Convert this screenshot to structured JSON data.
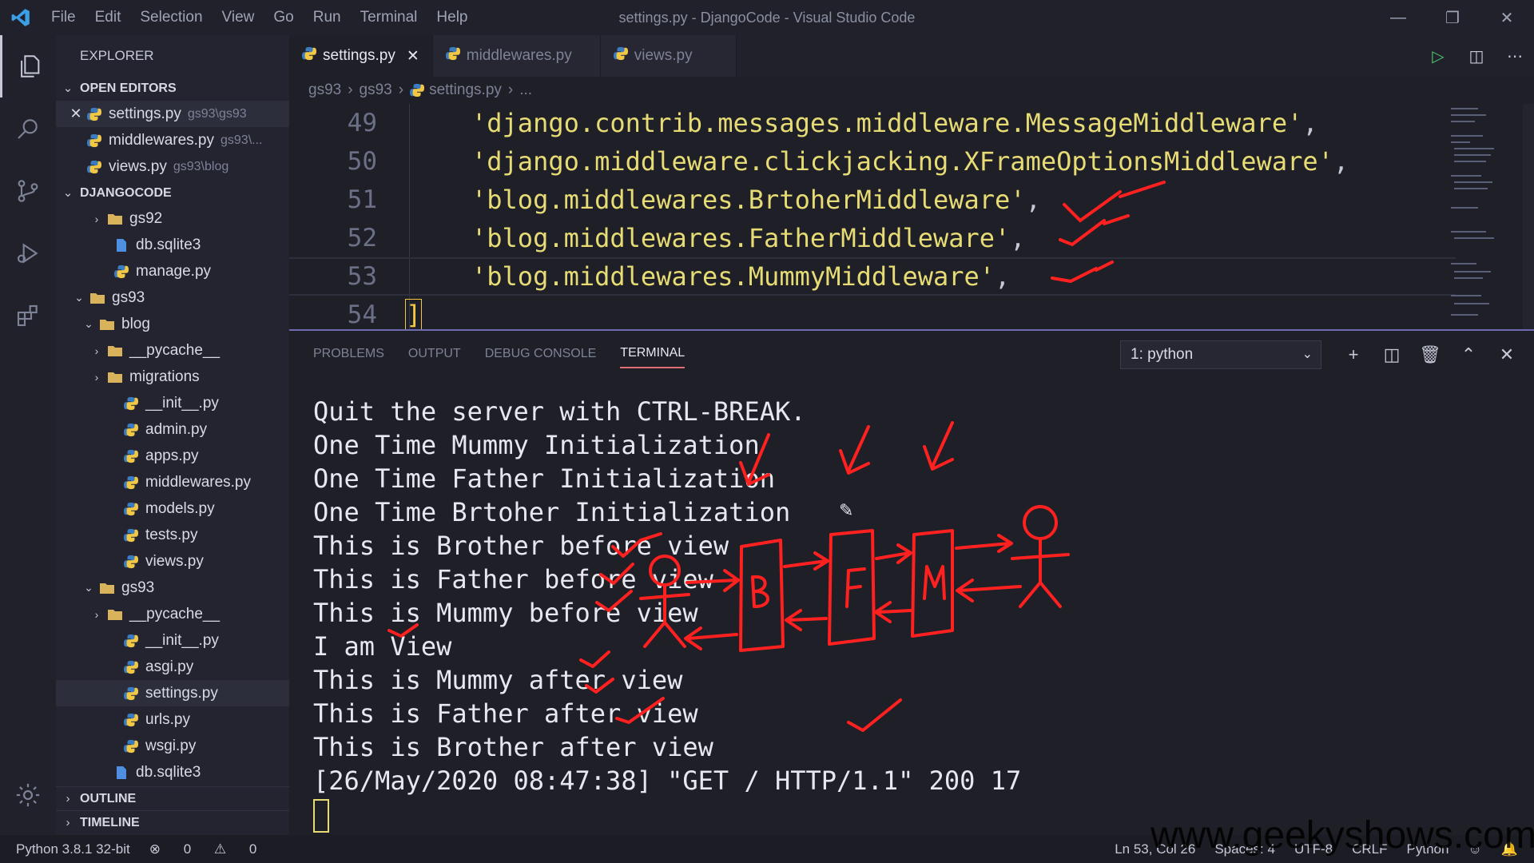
{
  "window": {
    "title": "settings.py - DjangoCode - Visual Studio Code",
    "menu": [
      "File",
      "Edit",
      "Selection",
      "View",
      "Go",
      "Run",
      "Terminal",
      "Help"
    ]
  },
  "sidebar": {
    "header": "EXPLORER",
    "open_editors_label": "OPEN EDITORS",
    "open_editors": [
      {
        "name": "settings.py",
        "path": "gs93\\gs93"
      },
      {
        "name": "middlewares.py",
        "path": "gs93\\..."
      },
      {
        "name": "views.py",
        "path": "gs93\\blog"
      }
    ],
    "project_label": "DJANGOCODE",
    "tree": [
      {
        "name": "gs92"
      },
      {
        "name": "db.sqlite3"
      },
      {
        "name": "manage.py"
      },
      {
        "name": "gs93"
      },
      {
        "name": "blog"
      },
      {
        "name": "__pycache__"
      },
      {
        "name": "migrations"
      },
      {
        "name": "__init__.py"
      },
      {
        "name": "admin.py"
      },
      {
        "name": "apps.py"
      },
      {
        "name": "middlewares.py"
      },
      {
        "name": "models.py"
      },
      {
        "name": "tests.py"
      },
      {
        "name": "views.py"
      },
      {
        "name": "gs93"
      },
      {
        "name": "__pycache__"
      },
      {
        "name": "__init__.py"
      },
      {
        "name": "asgi.py"
      },
      {
        "name": "settings.py"
      },
      {
        "name": "urls.py"
      },
      {
        "name": "wsgi.py"
      },
      {
        "name": "db.sqlite3"
      }
    ],
    "outline_label": "OUTLINE",
    "timeline_label": "TIMELINE"
  },
  "tabs": [
    {
      "label": "settings.py"
    },
    {
      "label": "middlewares.py"
    },
    {
      "label": "views.py"
    }
  ],
  "breadcrumb": [
    "gs93",
    "gs93",
    "settings.py",
    "..."
  ],
  "editor": {
    "lines": [
      {
        "num": "49",
        "text": "'django.contrib.messages.middleware.MessageMiddleware'",
        "punct": ","
      },
      {
        "num": "50",
        "text": "'django.middleware.clickjacking.XFrameOptionsMiddleware'",
        "punct": ","
      },
      {
        "num": "51",
        "text": "'blog.middlewares.BrtoherMiddleware'",
        "punct": ","
      },
      {
        "num": "52",
        "text": "'blog.middlewares.FatherMiddleware'",
        "punct": ","
      },
      {
        "num": "53",
        "text": "'blog.middlewares.MummyMiddleware'",
        "punct": ","
      },
      {
        "num": "54",
        "text": "",
        "punct": "]"
      }
    ]
  },
  "panel": {
    "tabs": [
      "PROBLEMS",
      "OUTPUT",
      "DEBUG CONSOLE",
      "TERMINAL"
    ],
    "terminal_select": "1: python",
    "terminal_lines": [
      "Quit the server with CTRL-BREAK.",
      "One Time Mummy Initialization",
      "One Time Father Initialization",
      "One Time Brtoher Initialization",
      "This is Brother before view",
      "This is Father before view",
      "This is Mummy before view",
      "I am View",
      "This is Mummy after view",
      "This is Father after view",
      "This is Brother after view",
      "[26/May/2020 08:47:38] \"GET / HTTP/1.1\" 200 17"
    ],
    "drawing_labels": [
      "B",
      "F",
      "M"
    ]
  },
  "status": {
    "interpreter": "Python 3.8.1 32-bit",
    "errors": "0",
    "warnings": "0",
    "position": "Ln 53, Col 26",
    "spaces": "Spaces: 4",
    "encoding": "UTF-8",
    "eol": "CRLF",
    "language": "Python"
  },
  "watermark": "www.geekyshows.com",
  "colors": {
    "annotation": "#ff2020",
    "string": "#e6db74",
    "accent": "#6f6bb0"
  }
}
